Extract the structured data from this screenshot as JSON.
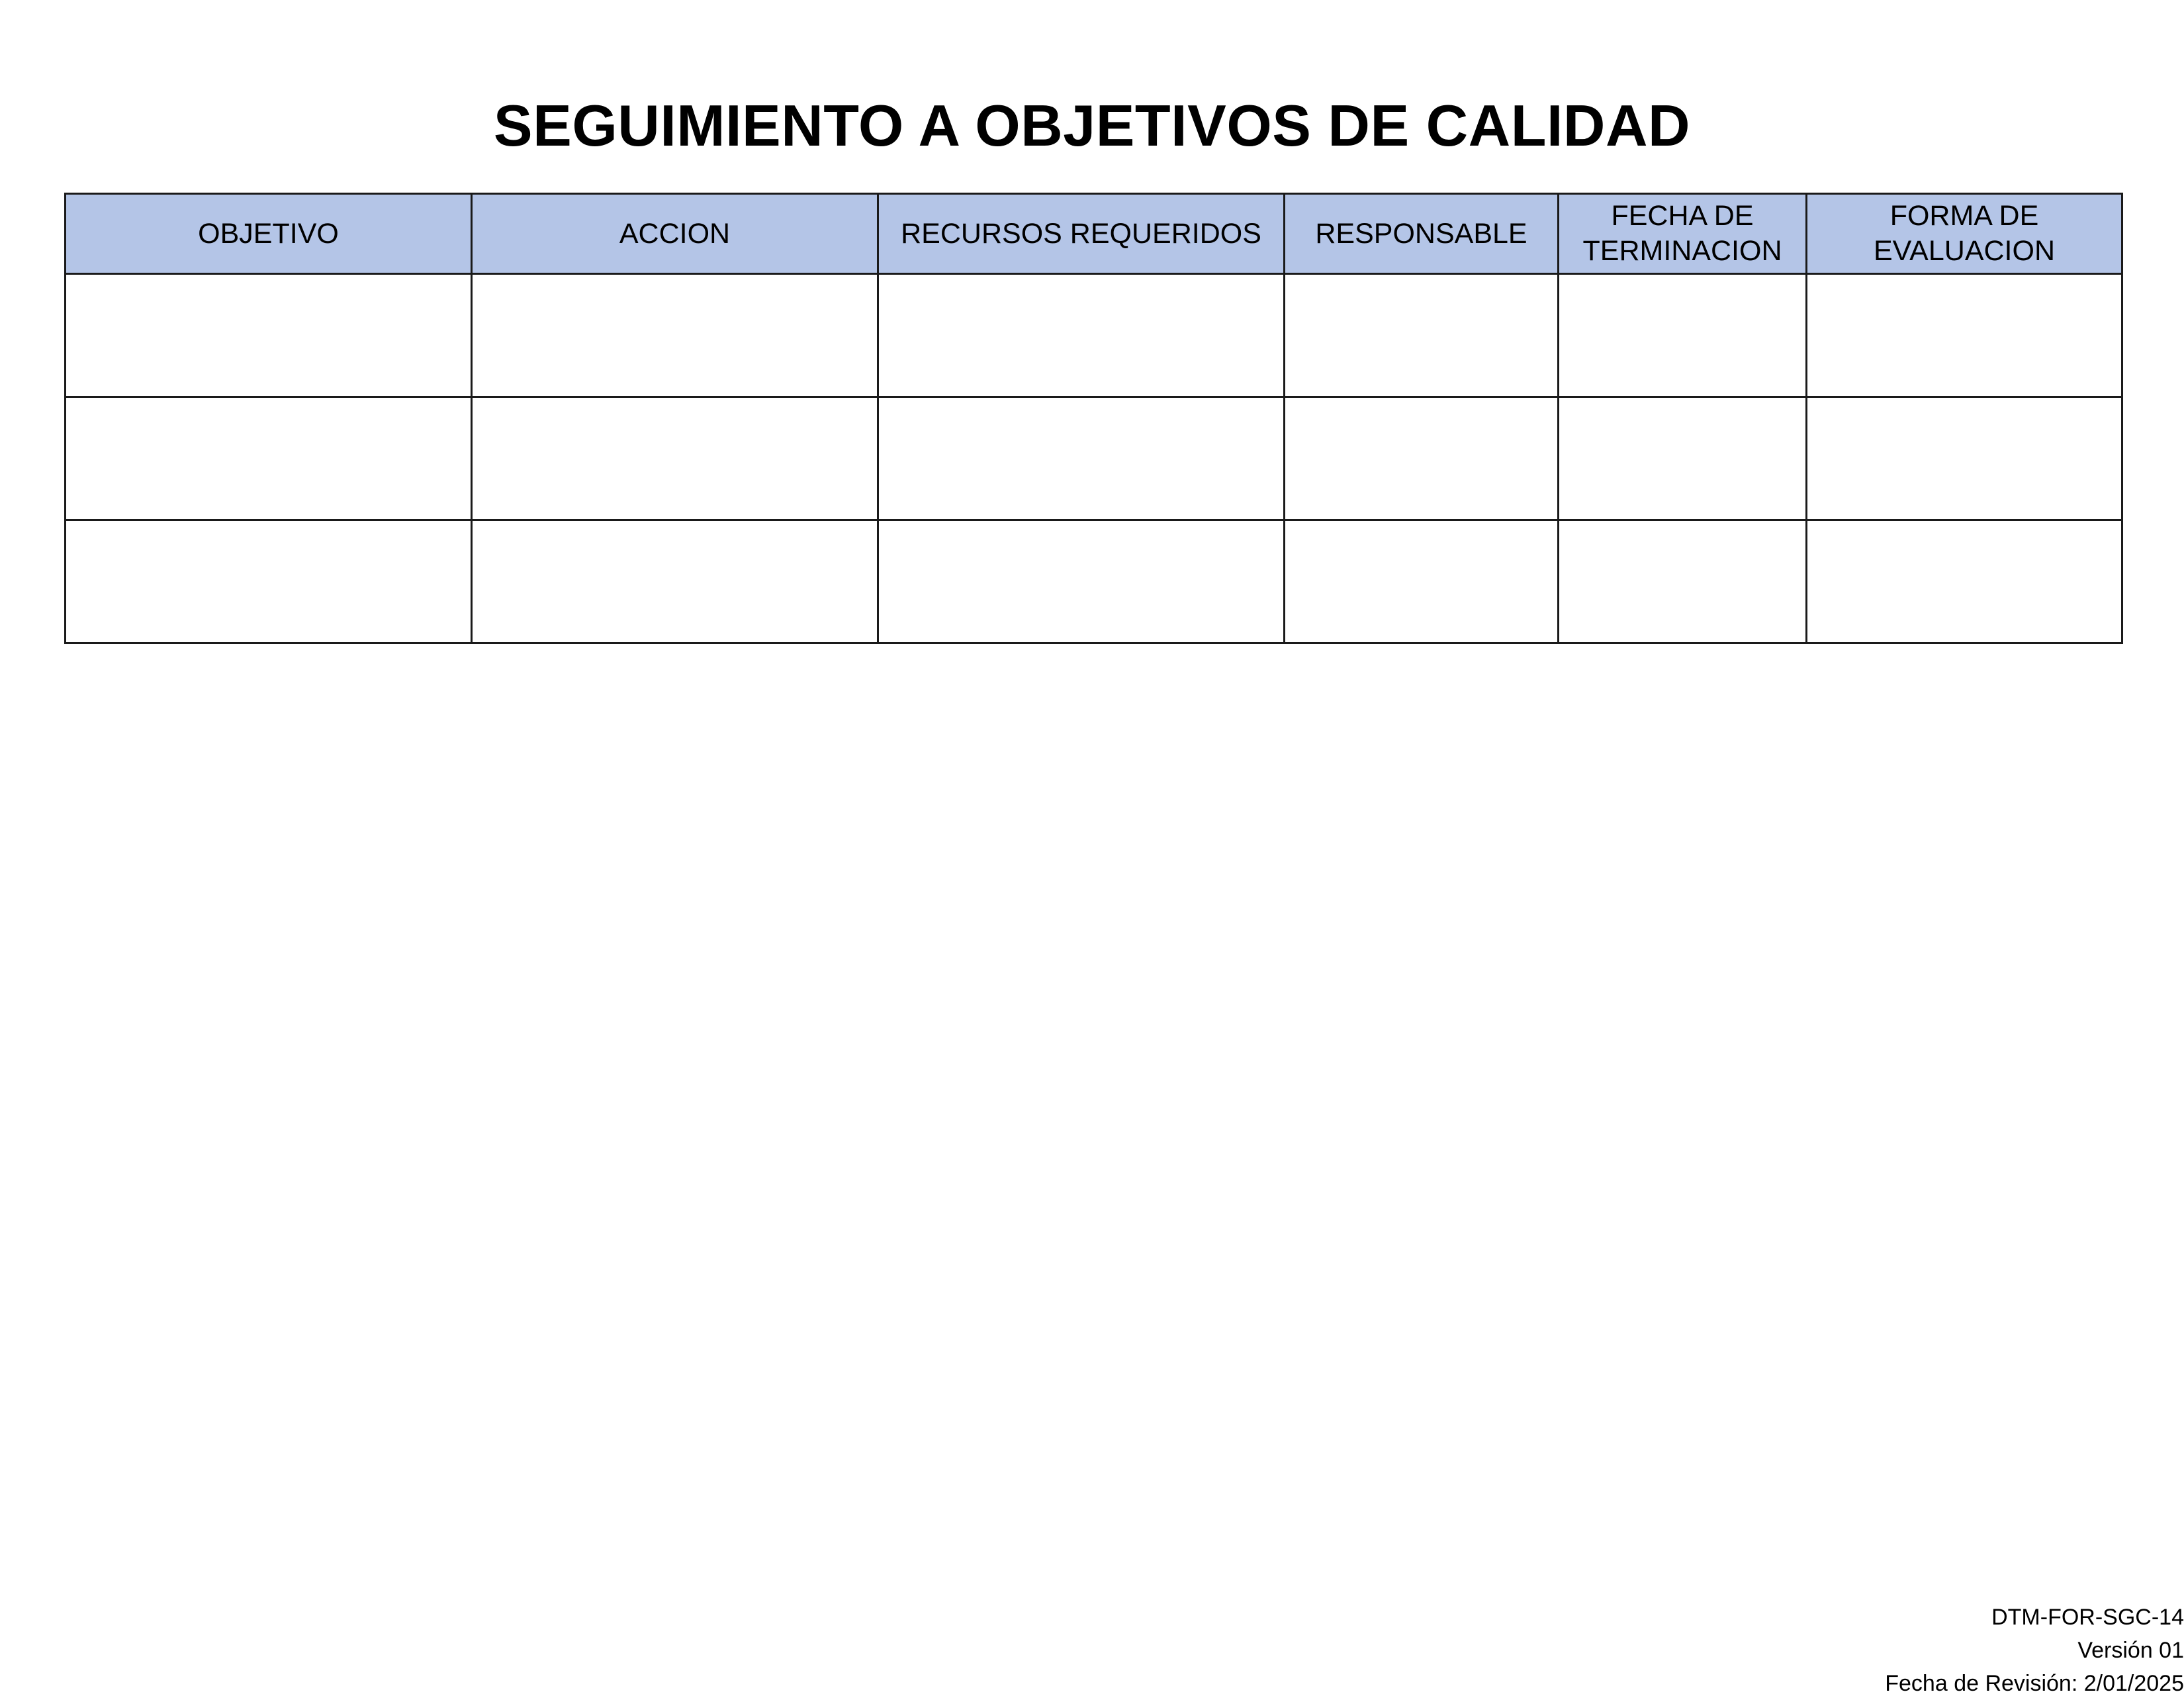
{
  "document": {
    "title": "SEGUIMIENTO A OBJETIVOS DE CALIDAD"
  },
  "table": {
    "headers": [
      {
        "line1": "OBJETIVO",
        "line2": ""
      },
      {
        "line1": "ACCION",
        "line2": ""
      },
      {
        "line1": "RECURSOS REQUERIDOS",
        "line2": ""
      },
      {
        "line1": "RESPONSABLE",
        "line2": ""
      },
      {
        "line1": "FECHA DE",
        "line2": "TERMINACION"
      },
      {
        "line1": "FORMA DE",
        "line2": "EVALUACION"
      }
    ],
    "header_color": "#b4c5e7",
    "rows": [
      [
        "",
        "",
        "",
        "",
        "",
        ""
      ],
      [
        "",
        "",
        "",
        "",
        "",
        ""
      ],
      [
        "",
        "",
        "",
        "",
        "",
        ""
      ]
    ]
  },
  "footer": {
    "code": "DTM-FOR-SGC-14",
    "version": "Versión 01",
    "revision_date": "Fecha de Revisión: 2/01/2025"
  }
}
